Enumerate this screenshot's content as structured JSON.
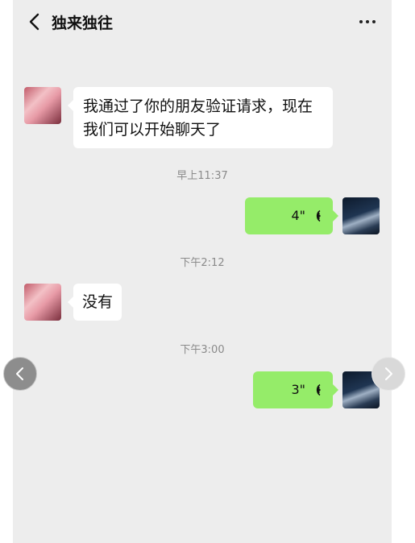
{
  "header": {
    "title": "独来独往",
    "back_icon": "chevron-left-icon",
    "more_icon": "more-dots-icon"
  },
  "messages": [
    {
      "side": "left",
      "type": "text",
      "text_line1": "我通过了你的朋友验证请求，现在",
      "text_line2": "我们可以开始聊天了"
    },
    {
      "type": "time",
      "text": "早上11:37"
    },
    {
      "side": "right",
      "type": "voice",
      "duration": "4\""
    },
    {
      "type": "time",
      "text": "下午2:12"
    },
    {
      "side": "left",
      "type": "text",
      "text": "没有"
    },
    {
      "type": "time",
      "text": "下午3:00"
    },
    {
      "side": "right",
      "type": "voice",
      "duration": "3\""
    }
  ],
  "colors": {
    "background": "#ededed",
    "my_bubble": "#95ec69",
    "their_bubble": "#ffffff",
    "time_text": "#8a8a8a"
  },
  "nav": {
    "prev_icon": "chevron-left-icon",
    "next_icon": "chevron-right-icon"
  }
}
